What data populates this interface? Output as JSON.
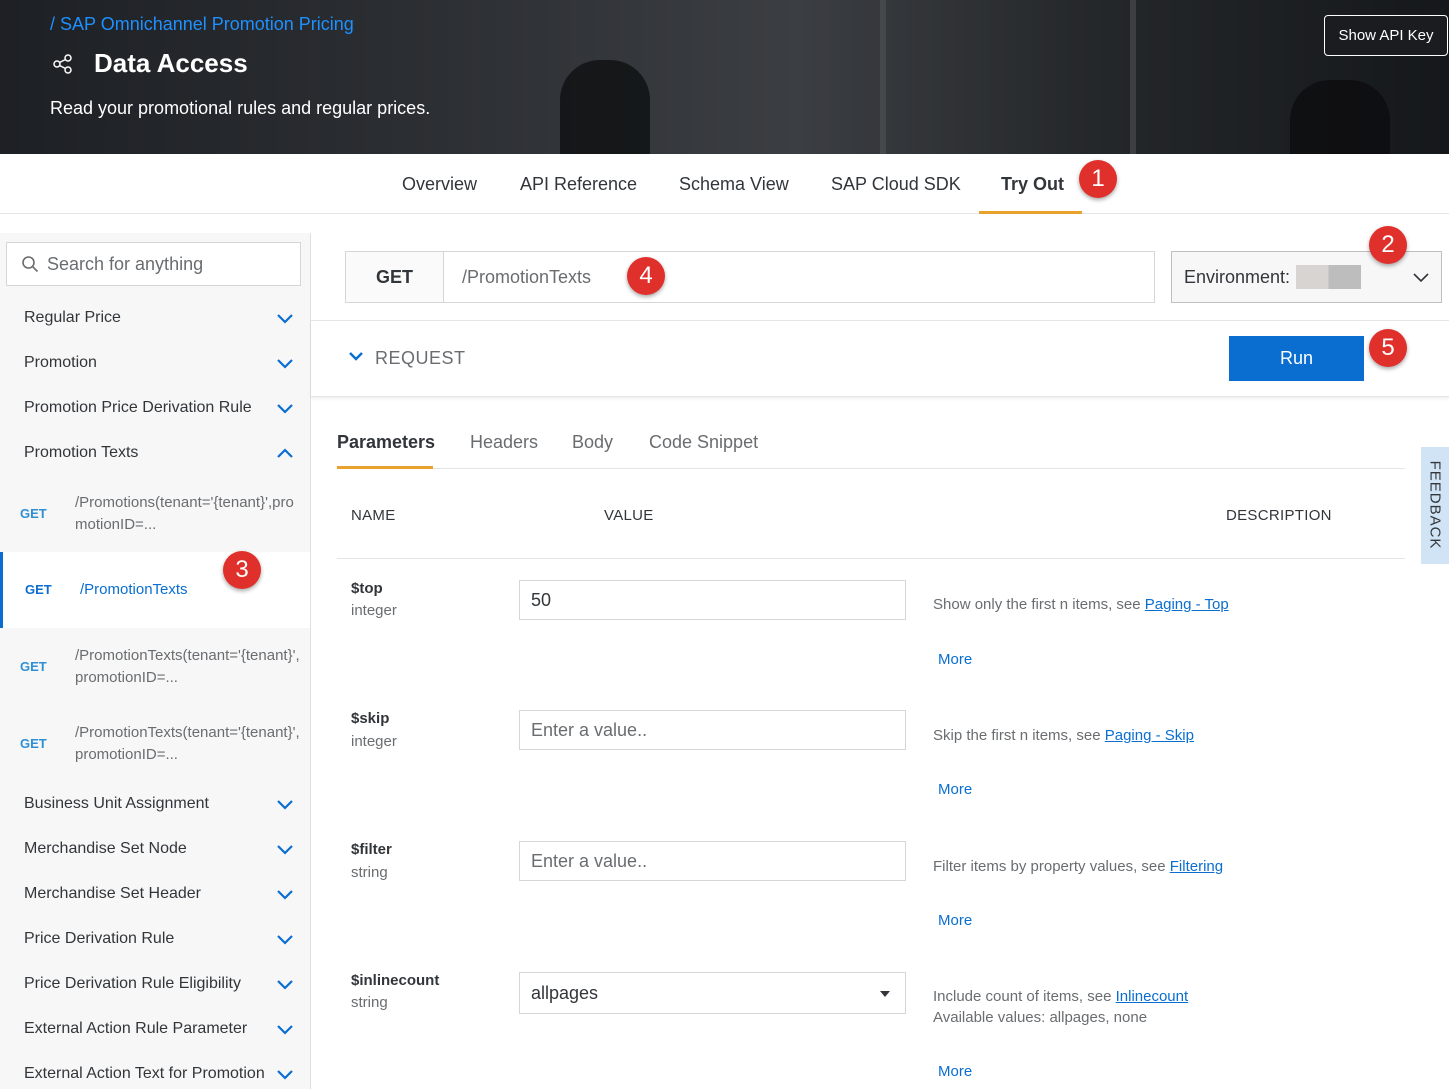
{
  "header": {
    "breadcrumb": "/ SAP Omnichannel Promotion Pricing",
    "title": "Data Access",
    "subtitle": "Read your promotional rules and regular prices.",
    "api_key_button": "Show API Key"
  },
  "tabs": [
    {
      "label": "Overview"
    },
    {
      "label": "API Reference"
    },
    {
      "label": "Schema View"
    },
    {
      "label": "SAP Cloud SDK"
    },
    {
      "label": "Try Out",
      "active": true
    }
  ],
  "markers": [
    "1",
    "2",
    "3",
    "4",
    "5"
  ],
  "sidebar": {
    "search_placeholder": "Search for anything",
    "groups_top": [
      {
        "label": "Regular Price",
        "expanded": false
      },
      {
        "label": "Promotion",
        "expanded": false
      },
      {
        "label": "Promotion Price Derivation Rule",
        "expanded": false
      },
      {
        "label": "Promotion Texts",
        "expanded": true
      }
    ],
    "endpoints": [
      {
        "method": "GET",
        "path": "/Promotions(tenant='{tenant}',promotionID=..."
      },
      {
        "method": "GET",
        "path": "/PromotionTexts",
        "selected": true
      },
      {
        "method": "GET",
        "path": "/PromotionTexts(tenant='{tenant}',promotionID=..."
      },
      {
        "method": "GET",
        "path": "/PromotionTexts(tenant='{tenant}',promotionID=..."
      }
    ],
    "groups_bottom": [
      {
        "label": "Business Unit Assignment"
      },
      {
        "label": "Merchandise Set Node"
      },
      {
        "label": "Merchandise Set Header"
      },
      {
        "label": "Price Derivation Rule"
      },
      {
        "label": "Price Derivation Rule Eligibility"
      },
      {
        "label": "External Action Rule Parameter"
      },
      {
        "label": "External Action Text for Promotion"
      }
    ]
  },
  "request_bar": {
    "method": "GET",
    "path": "/PromotionTexts",
    "environment_label": "Environment:"
  },
  "request_section": {
    "label": "REQUEST",
    "run_button": "Run"
  },
  "subtabs": [
    {
      "label": "Parameters",
      "active": true
    },
    {
      "label": "Headers"
    },
    {
      "label": "Body"
    },
    {
      "label": "Code Snippet"
    }
  ],
  "columns": {
    "name": "NAME",
    "value": "VALUE",
    "description": "DESCRIPTION"
  },
  "params": [
    {
      "name": "$top",
      "type": "integer",
      "value": "50",
      "placeholder": "Enter a value..",
      "desc": "Show only the first n items, see ",
      "link": "Paging - Top",
      "more": "More"
    },
    {
      "name": "$skip",
      "type": "integer",
      "value": "",
      "placeholder": "Enter a value..",
      "desc": "Skip the first n items, see ",
      "link": "Paging - Skip",
      "more": "More"
    },
    {
      "name": "$filter",
      "type": "string",
      "value": "",
      "placeholder": "Enter a value..",
      "desc": "Filter items by property values, see ",
      "link": "Filtering",
      "more": "More"
    },
    {
      "name": "$inlinecount",
      "type": "string",
      "value": "allpages",
      "desc": "Include count of items, see ",
      "link": "Inlinecount",
      "desc2": "Available values: allpages, none",
      "more": "More"
    }
  ],
  "feedback": "FEEDBACK",
  "colors": {
    "accent": "#0a6ed1",
    "tab_highlight": "#e9a22b",
    "marker": "#e0302c"
  }
}
